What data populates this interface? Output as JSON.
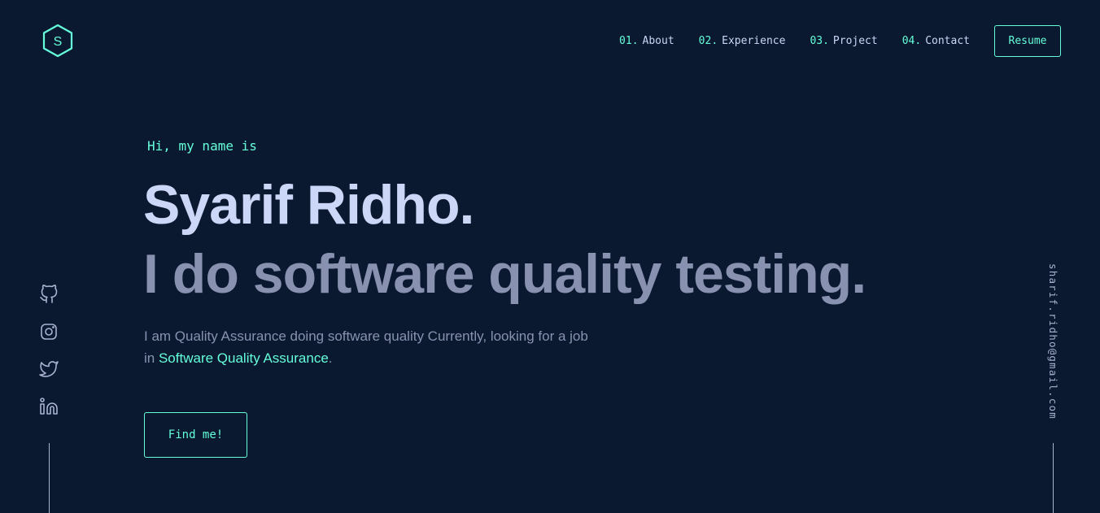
{
  "logo": {
    "letter": "S",
    "icon": "hexagon-logo-icon"
  },
  "nav": {
    "items": [
      {
        "num": "01.",
        "label": "About"
      },
      {
        "num": "02.",
        "label": "Experience"
      },
      {
        "num": "03.",
        "label": "Project"
      },
      {
        "num": "04.",
        "label": "Contact"
      }
    ],
    "resume_label": "Resume"
  },
  "hero": {
    "intro": "Hi, my name is",
    "name": "Syarif Ridho.",
    "tagline": "I do software quality testing.",
    "description_prefix": "I am Quality Assurance doing software quality Currently, looking for a job in ",
    "description_highlight": "Software Quality Assurance",
    "description_suffix": ".",
    "cta_label": "Find me!"
  },
  "social": {
    "icons": [
      "github-icon",
      "instagram-icon",
      "twitter-icon",
      "linkedin-icon"
    ]
  },
  "email": {
    "address": "sharif.ridho@gmail.com"
  },
  "colors": {
    "background": "#0b1930",
    "accent": "#64ffda",
    "heading": "#ccd6f6",
    "body_text": "#8892b0"
  }
}
